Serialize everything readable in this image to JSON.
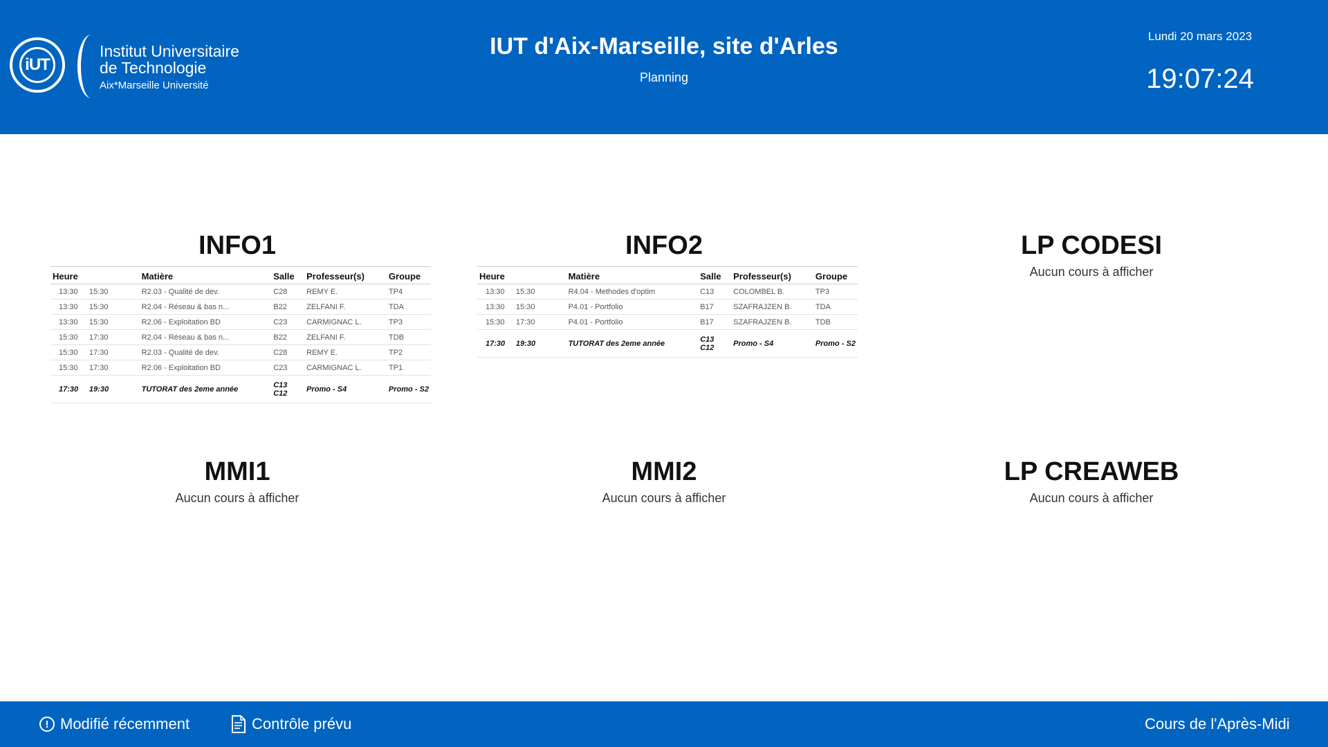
{
  "header": {
    "logo": {
      "mark": "iUT",
      "line1": "Institut Universitaire",
      "line2": "de Technologie",
      "line3": "Aix*Marseille Université"
    },
    "title": "IUT d'Aix-Marseille, site d'Arles",
    "subtitle": "Planning",
    "date": "Lundi 20 mars 2023",
    "time": "19:07:24"
  },
  "table_headers": {
    "heure": "Heure",
    "matiere": "Matière",
    "salle": "Salle",
    "prof": "Professeur(s)",
    "groupe": "Groupe"
  },
  "sections": {
    "info1": {
      "title": "INFO1",
      "rows": [
        {
          "start": "13:30",
          "end": "15:30",
          "matiere": "R2.03 - Qualité de dev.",
          "salle": "C28",
          "prof": "REMY E.",
          "groupe": "TP4"
        },
        {
          "start": "13:30",
          "end": "15:30",
          "matiere": "R2.04 - Réseau & bas n...",
          "salle": "B22",
          "prof": "ZELFANI F.",
          "groupe": "TDA"
        },
        {
          "start": "13:30",
          "end": "15:30",
          "matiere": "R2.06 - Exploitation BD",
          "salle": "C23",
          "prof": "CARMIGNAC L.",
          "groupe": "TP3"
        },
        {
          "start": "15:30",
          "end": "17:30",
          "matiere": "R2.04 - Réseau & bas n...",
          "salle": "B22",
          "prof": "ZELFANI F.",
          "groupe": "TDB"
        },
        {
          "start": "15:30",
          "end": "17:30",
          "matiere": "R2.03 - Qualité de dev.",
          "salle": "C28",
          "prof": "REMY E.",
          "groupe": "TP2"
        },
        {
          "start": "15:30",
          "end": "17:30",
          "matiere": "R2.06 - Exploitation BD",
          "salle": "C23",
          "prof": "CARMIGNAC L.",
          "groupe": "TP1"
        }
      ],
      "tutorat": {
        "start": "17:30",
        "end": "19:30",
        "matiere": "TUTORAT des 2eme année",
        "salle1": "C13",
        "salle2": "C12",
        "prof": "Promo - S4",
        "groupe": "Promo - S2"
      }
    },
    "info2": {
      "title": "INFO2",
      "rows": [
        {
          "start": "13:30",
          "end": "15:30",
          "matiere": "R4.04 - Methodes d'optim",
          "salle": "C13",
          "prof": "COLOMBEL B.",
          "groupe": "TP3"
        },
        {
          "start": "13:30",
          "end": "15:30",
          "matiere": "P4.01 - Portfolio",
          "salle": "B17",
          "prof": "SZAFRAJZEN B.",
          "groupe": "TDA"
        },
        {
          "start": "15:30",
          "end": "17:30",
          "matiere": "P4.01 - Portfolio",
          "salle": "B17",
          "prof": "SZAFRAJZEN B.",
          "groupe": "TDB"
        }
      ],
      "tutorat": {
        "start": "17:30",
        "end": "19:30",
        "matiere": "TUTORAT des 2eme année",
        "salle1": "C13",
        "salle2": "C12",
        "prof": "Promo - S4",
        "groupe": "Promo - S2"
      }
    },
    "lpcodesi": {
      "title": "LP CODESI",
      "empty": "Aucun cours à afficher"
    },
    "mmi1": {
      "title": "MMI1",
      "empty": "Aucun cours à afficher"
    },
    "mmi2": {
      "title": "MMI2",
      "empty": "Aucun cours à afficher"
    },
    "lpcreaweb": {
      "title": "LP CREAWEB",
      "empty": "Aucun cours à afficher"
    }
  },
  "footer": {
    "recent_label": "Modifié récemment",
    "recent_icon": "exclamation-circle-icon",
    "control_label": "Contrôle prévu",
    "control_icon": "document-list-icon",
    "period_label": "Cours de l'Après-Midi"
  },
  "colors": {
    "primary": "#0064c0"
  }
}
